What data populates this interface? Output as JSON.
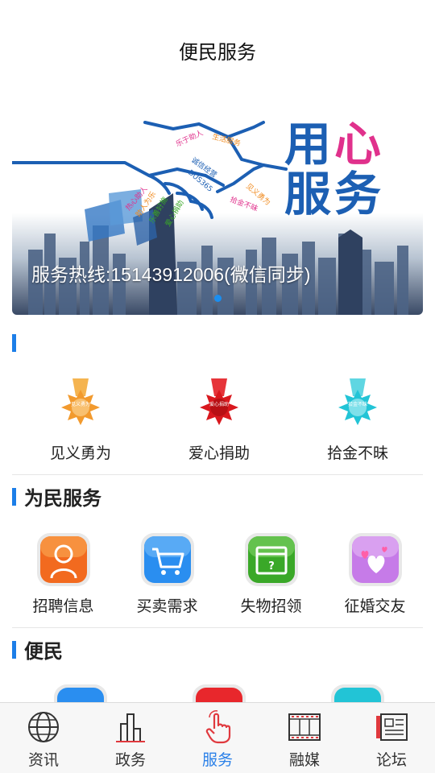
{
  "header": {
    "title": "便民服务"
  },
  "banner": {
    "caption": "服务热线:15143912006(微信同步)",
    "headline_line1_a": "用",
    "headline_line1_b": "心",
    "headline_line2": "服务",
    "hand_words": [
      "乐于助人",
      "生活服务",
      "诚信经营",
      "助人为乐",
      "热心助人",
      "DUS365",
      "见义勇为",
      "拾金不昧",
      "乐善好施",
      "爱心捐助"
    ]
  },
  "honor_section": {
    "items": [
      {
        "label": "见义勇为",
        "badge_text": "见义勇为",
        "color": "#f29a2e"
      },
      {
        "label": "爱心捐助",
        "badge_text": "爱心捐助",
        "color": "#d9181e"
      },
      {
        "label": "拾金不昧",
        "badge_text": "拾金不昧",
        "color": "#22c4d6"
      }
    ]
  },
  "service_section": {
    "title": "为民服务",
    "items": [
      {
        "label": "招聘信息",
        "icon": "person-icon",
        "color": "#f26a1f"
      },
      {
        "label": "买卖需求",
        "icon": "cart-icon",
        "color": "#2a8ef0"
      },
      {
        "label": "失物招领",
        "icon": "window-question-icon",
        "color": "#3aa828"
      },
      {
        "label": "征婚交友",
        "icon": "hearts-icon",
        "color": "#c67be8"
      }
    ]
  },
  "convenience_section": {
    "title": "便民"
  },
  "tabbar": {
    "tabs": [
      {
        "label": "资讯",
        "icon": "globe-icon"
      },
      {
        "label": "政务",
        "icon": "buildings-icon"
      },
      {
        "label": "服务",
        "icon": "hand-pointer-icon",
        "active": true
      },
      {
        "label": "融媒",
        "icon": "film-icon"
      },
      {
        "label": "论坛",
        "icon": "newspaper-icon"
      }
    ],
    "active_color": "#2a80e8"
  }
}
